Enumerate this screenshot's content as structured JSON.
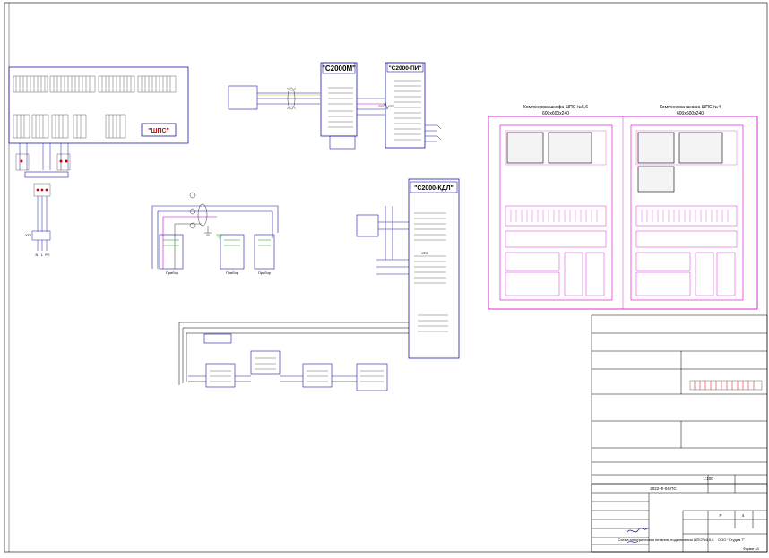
{
  "colors": {
    "wire_blue": "#1a1aa8",
    "cabinet_magenta": "#cc00cc",
    "ground_green": "#00a000",
    "accent_red": "#d00000",
    "cable_yellow": "#e0c000",
    "frame_gray": "#777777"
  },
  "blocks": {
    "shps": "\"ШПС\"",
    "s2000m": "\"С2000М\"",
    "s2000pi": "\"С2000-ПИ\"",
    "s2000kdl": "\"С2000-КДЛ\""
  },
  "cabinets": {
    "left": {
      "title": "Компоновка шкафа ШПС №5,6",
      "size": "600х600х240"
    },
    "right": {
      "title": "Компоновка шкафа ШПС №4",
      "size": "600х600х240"
    }
  },
  "terminals": {
    "xt1": "ХТ1",
    "xt2": "ХТ2",
    "n": "N",
    "l": "L",
    "pe": "PE"
  },
  "devices": {
    "pribor": "Прибор"
  },
  "title_block": {
    "project_code": "2022-Ф-04-ПС",
    "stage": "Р",
    "sheet": "4",
    "sheets": "",
    "scale": "1:100",
    "sheet_title": "Схема электрическая питания, подключения ШПС№4,5,6",
    "owner": "ООО \"Студия 7\"",
    "format": "Формат А3"
  },
  "icons": [
    "cable-twist-icon",
    "ground-icon",
    "signature-icon"
  ]
}
